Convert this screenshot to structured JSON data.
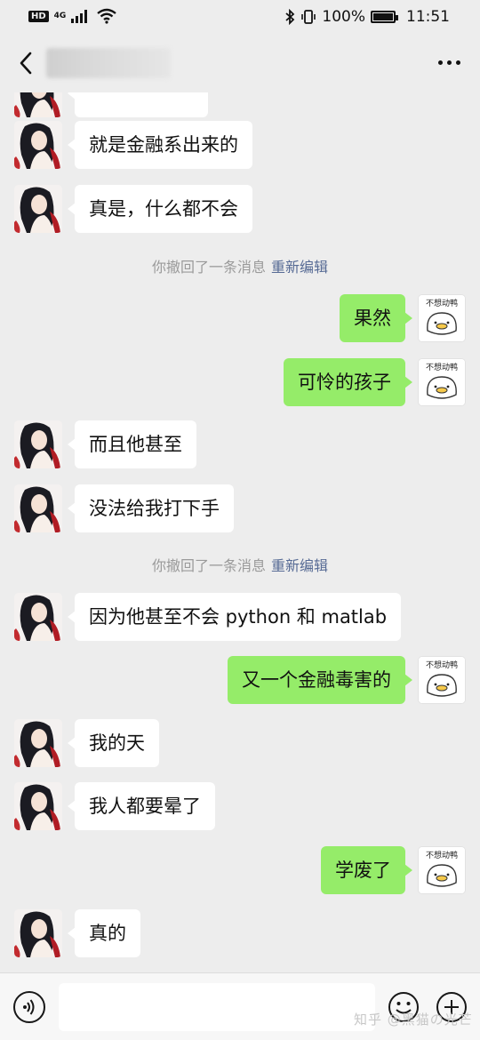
{
  "status_bar": {
    "hd": "HD",
    "network": "4G",
    "battery": "100%",
    "time": "11:51"
  },
  "header": {
    "title": "",
    "back_icon": "chevron-left-icon",
    "more_icon": "more-dots-icon"
  },
  "messages": [
    {
      "side": "in",
      "text": "就是金融系出来的"
    },
    {
      "side": "in",
      "text": "真是，什么都不会"
    },
    {
      "type": "system",
      "text": "你撤回了一条消息",
      "action": "重新编辑"
    },
    {
      "side": "out",
      "text": "果然"
    },
    {
      "side": "out",
      "text": "可怜的孩子"
    },
    {
      "side": "in",
      "text": "而且他甚至"
    },
    {
      "side": "in",
      "text": "没法给我打下手"
    },
    {
      "type": "system",
      "text": "你撤回了一条消息",
      "action": "重新编辑"
    },
    {
      "side": "in",
      "text": "因为他甚至不会 python 和 matlab"
    },
    {
      "side": "out",
      "text": "又一个金融毒害的"
    },
    {
      "side": "in",
      "text": "我的天"
    },
    {
      "side": "in",
      "text": "我人都要晕了"
    },
    {
      "side": "out",
      "text": "学废了"
    },
    {
      "side": "in",
      "text": "真的"
    }
  ],
  "duck_avatar_text": "不想动鸭",
  "input": {
    "placeholder": "",
    "value": ""
  },
  "toolbar": {
    "voice_icon": "voice-icon",
    "emoji_icon": "emoji-icon",
    "plus_icon": "plus-icon"
  },
  "watermark": "知乎 @黑猫の光芒",
  "colors": {
    "background": "#ededed",
    "outgoing_bubble": "#95ec69",
    "incoming_bubble": "#ffffff",
    "edit_link": "#576b95"
  }
}
